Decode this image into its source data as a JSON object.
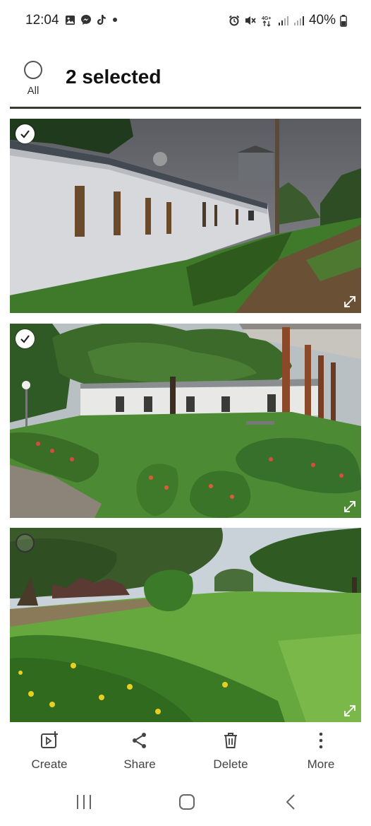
{
  "status_bar": {
    "time": "12:04",
    "left_icons": [
      "gallery-icon",
      "messenger-icon",
      "tiktok-icon",
      "dot-icon"
    ],
    "right_icons": [
      "alarm-icon",
      "mute-icon",
      "network-4g-icon",
      "signal-icon",
      "signal-icon"
    ],
    "battery_text": "40%"
  },
  "header": {
    "select_all_label": "All",
    "selected_text": "2 selected"
  },
  "photos": [
    {
      "name": "white-building-photo",
      "selected": true
    },
    {
      "name": "garden-tree-photo",
      "selected": true
    },
    {
      "name": "lawn-photo",
      "selected": false
    }
  ],
  "actions": {
    "create": "Create",
    "share": "Share",
    "delete": "Delete",
    "more": "More"
  },
  "navigation": [
    "recents-button",
    "home-button",
    "back-button"
  ],
  "colors": {
    "check_selected": "#ffffff",
    "accent_text": "#111111"
  }
}
